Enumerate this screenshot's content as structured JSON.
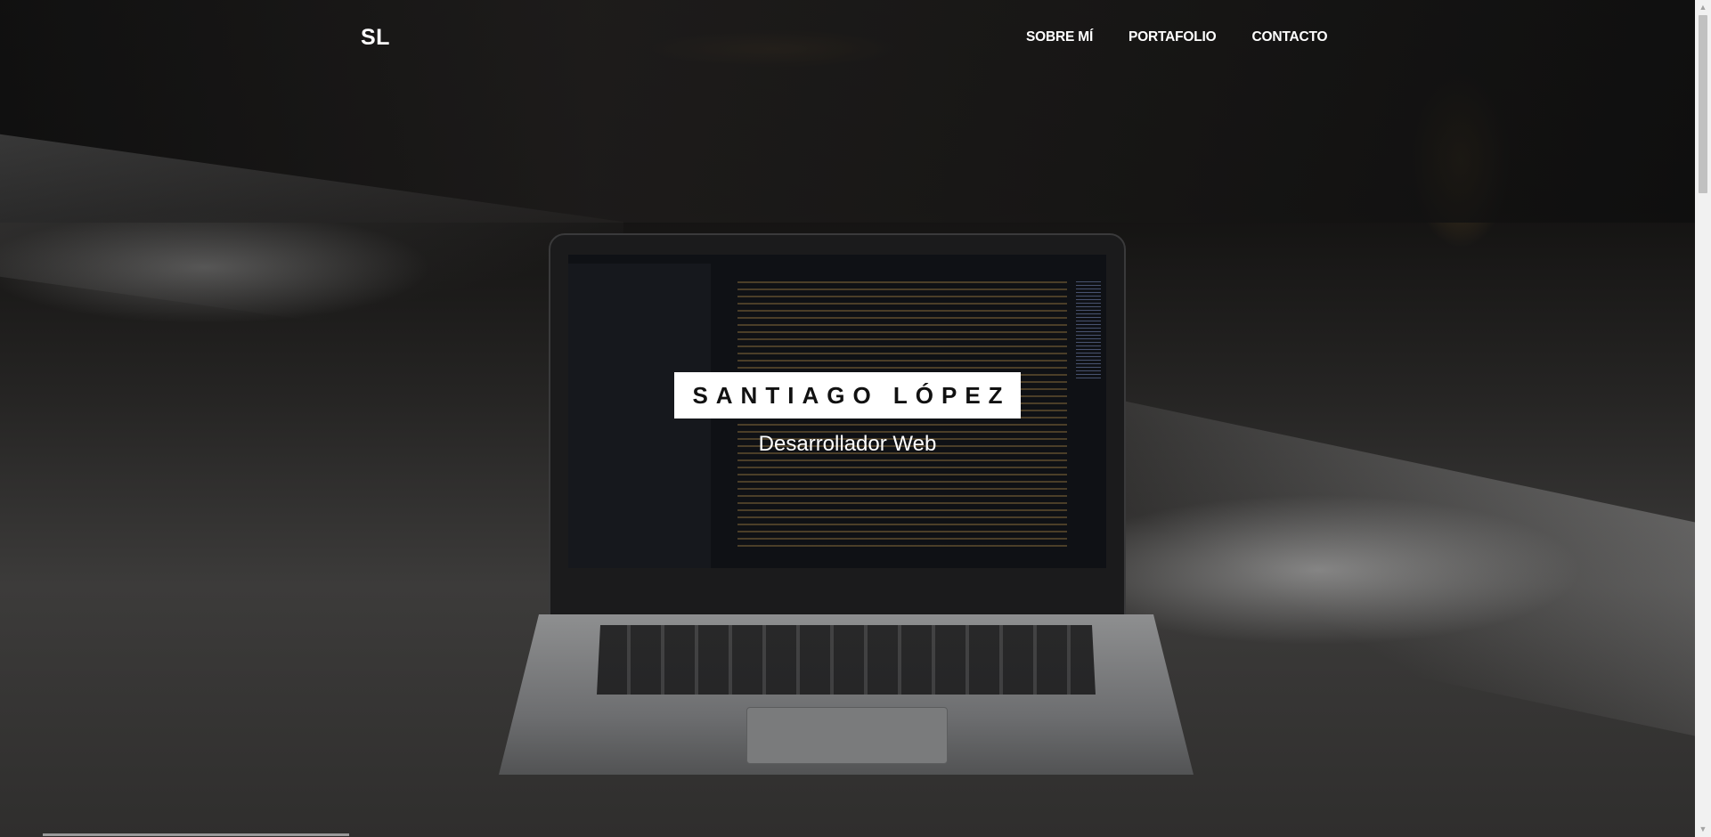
{
  "brand": {
    "logo_text": "SL"
  },
  "nav": {
    "items": [
      {
        "label": "SOBRE MÍ"
      },
      {
        "label": "PORTAFOLIO"
      },
      {
        "label": "CONTACTO"
      }
    ]
  },
  "hero": {
    "title": "SANTIAGO LÓPEZ",
    "subtitle": "Desarrollador Web",
    "background_description_icon": "laptop-code-photo"
  },
  "scrollbar": {
    "up_icon": "▲",
    "down_icon": "▼"
  },
  "colors": {
    "title_box_bg": "#ffffff",
    "title_text": "#111111",
    "nav_text": "#ffffff"
  }
}
